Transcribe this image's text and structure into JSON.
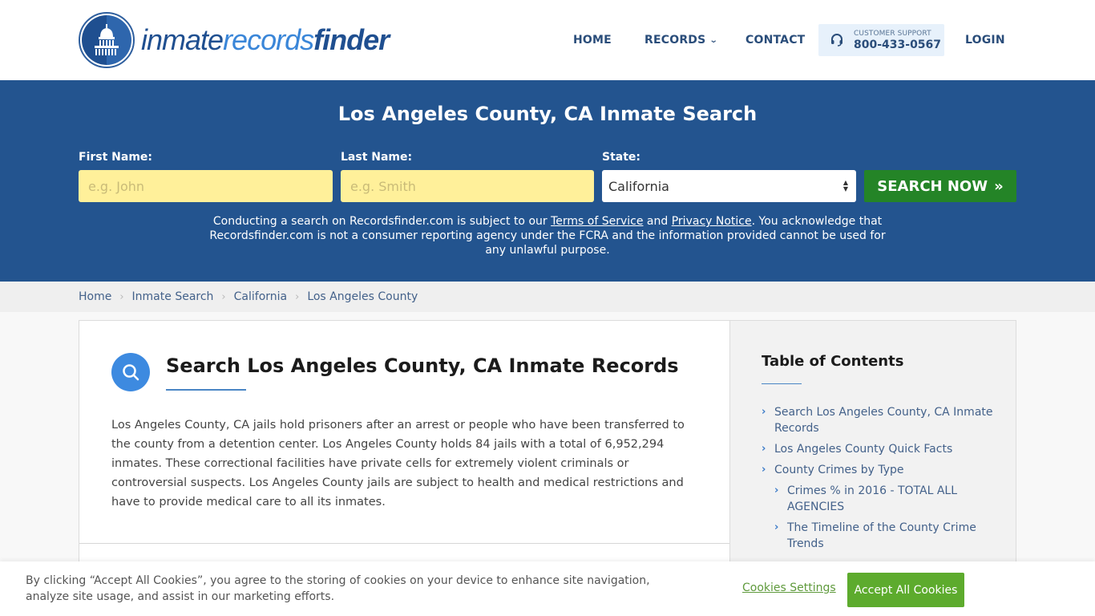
{
  "header": {
    "logo": {
      "part1": "inmate",
      "part2": "records",
      "part3": "finder",
      "icon": "capitol-building-icon"
    },
    "nav": [
      {
        "label": "HOME"
      },
      {
        "label": "RECORDS",
        "has_dropdown": true
      },
      {
        "label": "CONTACT"
      }
    ],
    "support": {
      "icon": "headset-icon",
      "label": "CUSTOMER SUPPORT",
      "phone": "800-433-0567"
    },
    "login_label": "LOGIN"
  },
  "search": {
    "title": "Los Angeles County, CA Inmate Search",
    "first_name": {
      "label": "First Name:",
      "placeholder": "e.g. John",
      "value": ""
    },
    "last_name": {
      "label": "Last Name:",
      "placeholder": "e.g. Smith",
      "value": ""
    },
    "state": {
      "label": "State:",
      "selected": "California"
    },
    "button_label": "SEARCH NOW",
    "button_icon": "double-chevron-right-icon",
    "disclaimer": {
      "part1": "Conducting a search on Recordsfinder.com is subject to our ",
      "terms_link": "Terms of Service",
      "part2": " and ",
      "privacy_link": "Privacy Notice",
      "part3": ". You acknowledge that Recordsfinder.com is not a consumer reporting agency under the FCRA and the information provided cannot be used for any unlawful purpose."
    }
  },
  "breadcrumb": [
    {
      "label": "Home"
    },
    {
      "label": "Inmate Search"
    },
    {
      "label": "California"
    },
    {
      "label": "Los Angeles County"
    }
  ],
  "main": {
    "section_icon": "search-icon",
    "section_title": "Search Los Angeles County, CA Inmate Records",
    "body": "Los Angeles County, CA jails hold prisoners after an arrest or people who have been transferred to the county from a detention center. Los Angeles County holds 84 jails with a total of 6,952,294 inmates. These correctional facilities have private cells for extremely violent criminals or controversial suspects. Los Angeles County jails are subject to health and medical restrictions and have to provide medical care to all its inmates."
  },
  "toc": {
    "title": "Table of Contents",
    "items": [
      {
        "label": "Search Los Angeles County, CA Inmate Records",
        "level": 1
      },
      {
        "label": "Los Angeles County Quick Facts",
        "level": 1
      },
      {
        "label": "County Crimes by Type",
        "level": 1
      },
      {
        "label": "Crimes % in 2016 - TOTAL ALL AGENCIES",
        "level": 2
      },
      {
        "label": "The Timeline of the County Crime Trends",
        "level": 2
      }
    ]
  },
  "cookie_banner": {
    "text": "By clicking “Accept All Cookies”, you agree to the storing of cookies on your device to enhance site navigation, analyze site usage, and assist in our marketing efforts.",
    "settings_label": "Cookies Settings",
    "accept_label": "Accept All Cookies"
  },
  "colors": {
    "brand_blue": "#23548f",
    "nav_text": "#2a4d7a",
    "search_button": "#248427",
    "input_bg": "#fff09a",
    "accent_blue": "#3d8ae0",
    "cookie_accept": "#5dab2d"
  }
}
